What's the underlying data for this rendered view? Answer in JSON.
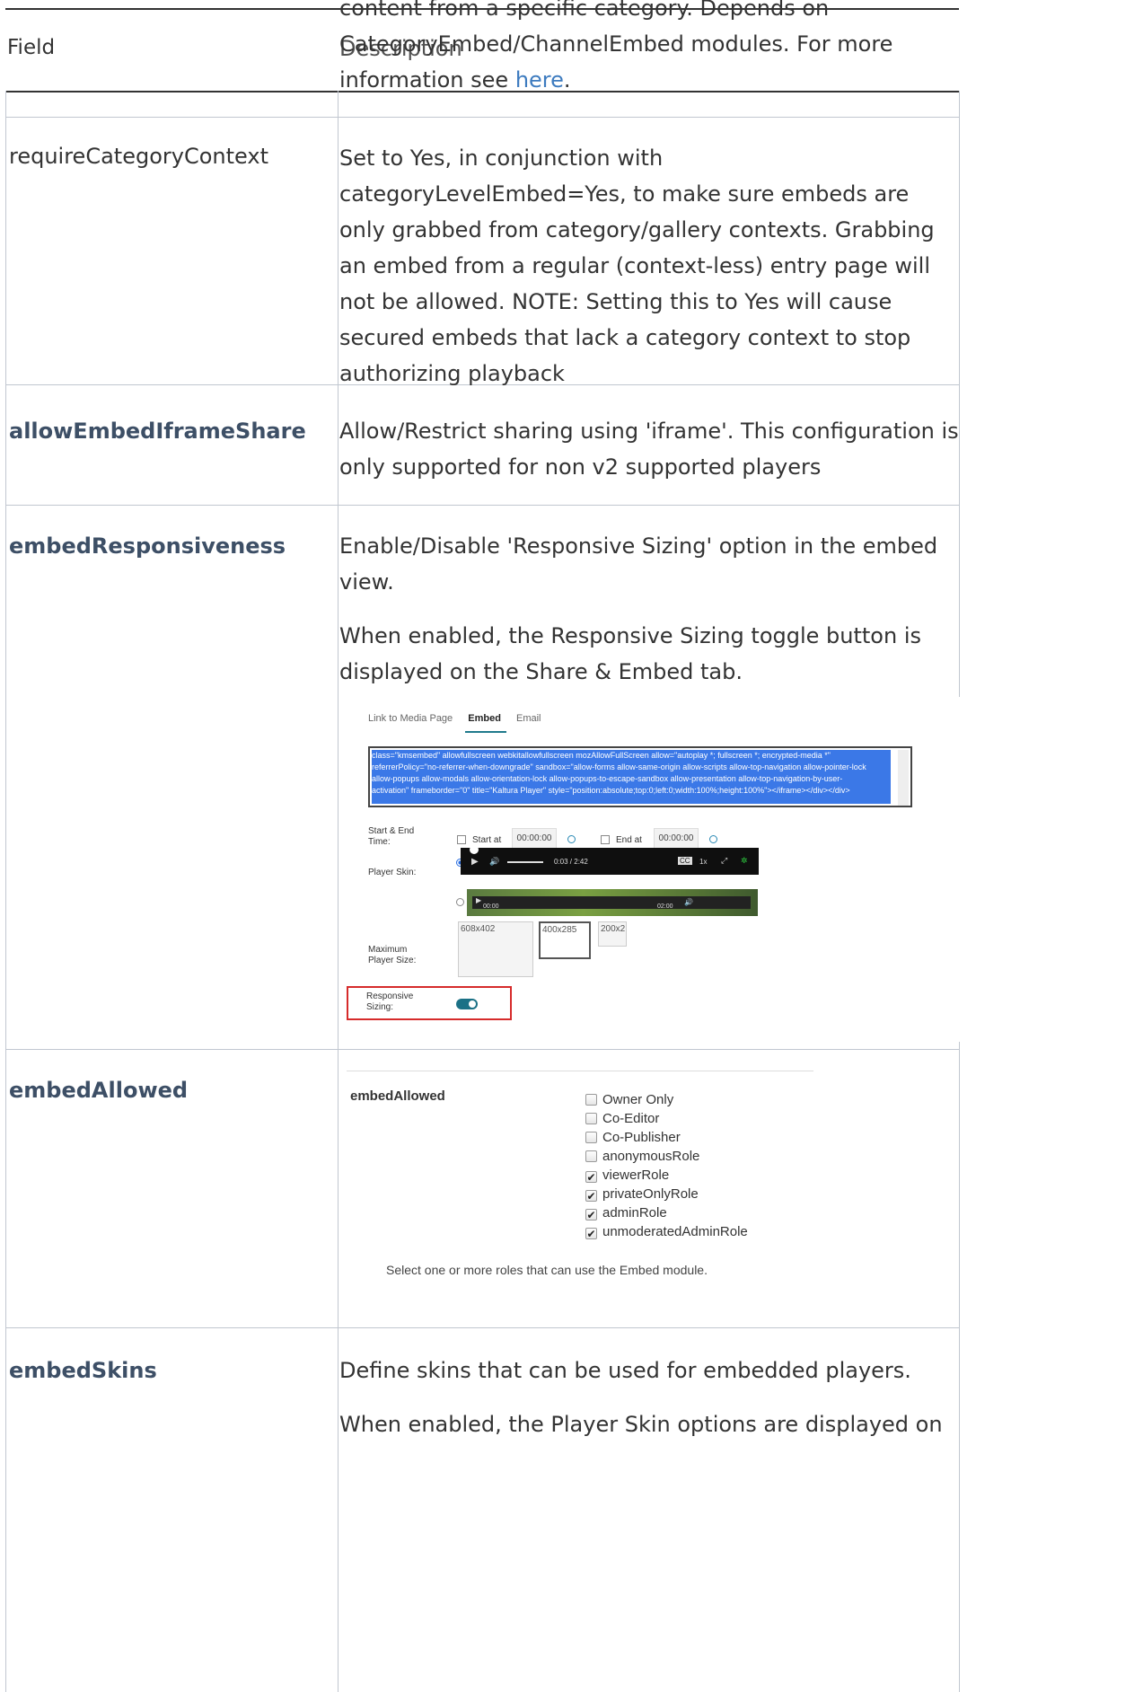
{
  "header": {
    "field_label": "Field",
    "description_label": "Description",
    "overflow_text_line1": "content from a specific category. Depends on",
    "overflow_text_line2": "CategoryEmbed/ChannelEmbed modules. For more",
    "overflow_text_line3_prefix": "information see ",
    "overflow_link": "here",
    "overflow_text_line3_suffix": "."
  },
  "rows": {
    "requireCategoryContext": {
      "field": "requireCategoryContext",
      "lines": [
        "Set to Yes, in conjunction with",
        "categoryLevelEmbed=Yes, to make sure embeds are",
        "only grabbed from category/gallery contexts. Grabbing",
        "an embed from a regular (context-less) entry page will",
        "not be allowed. NOTE: Setting this to Yes will cause",
        "secured embeds that lack a category context to stop",
        "authorizing playback"
      ]
    },
    "allowEmbedIframeShare": {
      "field": "allowEmbedIframeShare",
      "lines": [
        "Allow/Restrict sharing using 'iframe'. This configuration is",
        "only supported for non v2 supported players"
      ]
    },
    "embedResponsiveness": {
      "field": "embedResponsiveness",
      "p1_lines": [
        "Enable/Disable 'Responsive Sizing' option in the embed",
        "view."
      ],
      "p2_lines": [
        "When enabled, the Responsive Sizing toggle button is",
        "displayed on the Share & Embed tab."
      ]
    },
    "embedAllowed": {
      "field": "embedAllowed"
    },
    "embedSkins": {
      "field": "embedSkins",
      "line1": "Define skins that can be used for embedded players.",
      "line2": "When enabled, the Player Skin options are displayed on"
    }
  },
  "embed_screenshot": {
    "tabs": [
      "Link to Media Page",
      "Embed",
      "Email"
    ],
    "code_lines": [
      "class=\"kmsembed\" allowfullscreen webkitallowfullscreen mozAllowFullScreen allow=\"autoplay *; fullscreen *; encrypted-media *\"",
      "referrerPolicy=\"no-referrer-when-downgrade\" sandbox=\"allow-forms allow-same-origin allow-scripts allow-top-navigation allow-pointer-lock",
      "allow-popups allow-modals allow-orientation-lock allow-popups-to-escape-sandbox allow-presentation allow-top-navigation-by-user-",
      "activation\" frameborder=\"0\" title=\"Kaltura Player\" style=\"position:absolute;top:0;left:0;width:100%;height:100%\"></iframe></div></div>"
    ],
    "start_end_label": "Start & End Time:",
    "start_at_label": "Start at",
    "start_time": "00:00:00",
    "end_at_label": "End at",
    "end_time": "00:00:00",
    "player_skin_label": "Player Skin:",
    "player1_time": "0:03 / 2:42",
    "player1_speed": "1x",
    "player2_time_left": "00:00",
    "player2_time_right": "02:00",
    "max_size_label": "Maximum Player Size:",
    "sizes": [
      "608x402",
      "400x285",
      "200x2"
    ],
    "responsive_label": "Responsive Sizing:"
  },
  "embed_allowed_panel": {
    "title": "embedAllowed",
    "roles": [
      {
        "label": "Owner Only",
        "checked": false
      },
      {
        "label": "Co-Editor",
        "checked": false
      },
      {
        "label": "Co-Publisher",
        "checked": false
      },
      {
        "label": "anonymousRole",
        "checked": false
      },
      {
        "label": "viewerRole",
        "checked": true
      },
      {
        "label": "privateOnlyRole",
        "checked": true
      },
      {
        "label": "adminRole",
        "checked": true
      },
      {
        "label": "unmoderatedAdminRole",
        "checked": true
      }
    ],
    "hint": "Select one or more roles that can use the Embed module."
  }
}
